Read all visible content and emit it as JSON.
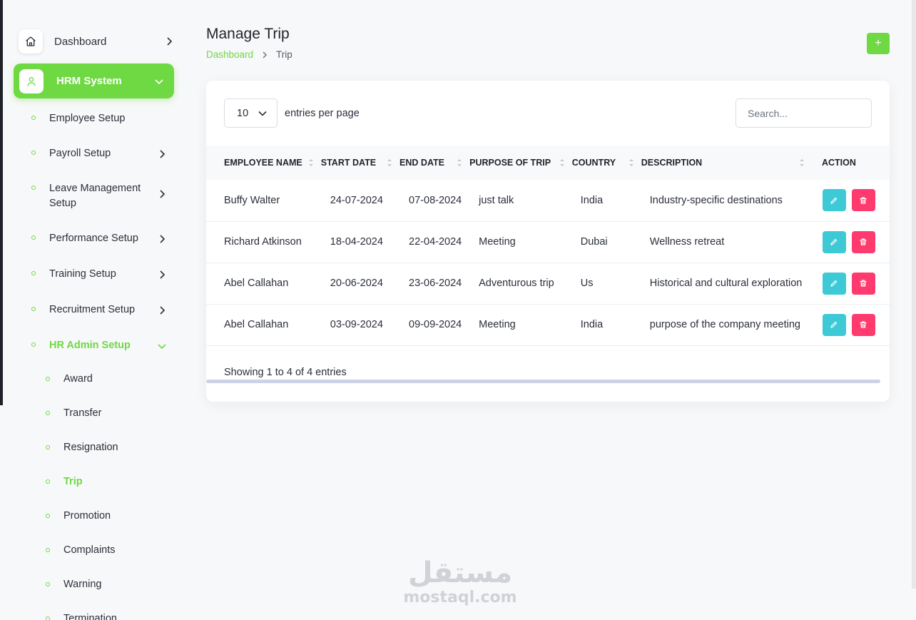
{
  "sidebar": {
    "dashboard": "Dashboard",
    "hrm": "HRM System",
    "items": [
      {
        "label": "Employee Setup"
      },
      {
        "label": "Payroll Setup"
      },
      {
        "label": "Leave Management Setup"
      },
      {
        "label": "Performance Setup"
      },
      {
        "label": "Training Setup"
      },
      {
        "label": "Recruitment Setup"
      },
      {
        "label": "HR Admin Setup"
      }
    ],
    "subitems": [
      {
        "label": "Award"
      },
      {
        "label": "Transfer"
      },
      {
        "label": "Resignation"
      },
      {
        "label": "Trip"
      },
      {
        "label": "Promotion"
      },
      {
        "label": "Complaints"
      },
      {
        "label": "Warning"
      },
      {
        "label": "Termination"
      }
    ]
  },
  "header": {
    "title": "Manage Trip",
    "breadcrumb_home": "Dashboard",
    "breadcrumb_current": "Trip",
    "add_label": "+"
  },
  "table": {
    "page_size": "10",
    "entries_label": "entries per page",
    "search_placeholder": "Search...",
    "columns": [
      "Employee Name",
      "Start Date",
      "End Date",
      "Purpose of Trip",
      "Country",
      "Description",
      "Action"
    ],
    "rows": [
      {
        "name": "Buffy Walter",
        "start": "24-07-2024",
        "end": "07-08-2024",
        "purpose": "just talk",
        "country": "India",
        "description": "Industry-specific destinations"
      },
      {
        "name": "Richard Atkinson",
        "start": "18-04-2024",
        "end": "22-04-2024",
        "purpose": "Meeting",
        "country": "Dubai",
        "description": "Wellness retreat"
      },
      {
        "name": "Abel Callahan",
        "start": "20-06-2024",
        "end": "23-06-2024",
        "purpose": "Adventurous trip",
        "country": "Us",
        "description": "Historical and cultural exploration"
      },
      {
        "name": "Abel Callahan",
        "start": "03-09-2024",
        "end": "09-09-2024",
        "purpose": "Meeting",
        "country": "India",
        "description": "purpose of the company meeting"
      }
    ],
    "info": "Showing 1 to 4 of 4 entries"
  },
  "watermark": {
    "arabic": "مستقل",
    "latin": "mostaql.com"
  },
  "colors": {
    "accent": "#6fd943",
    "edit": "#3ec9d6",
    "delete": "#ff3a6e"
  },
  "icons": {
    "dashboard": "home-icon",
    "hrm": "user-icon",
    "edit": "pencil-icon",
    "delete": "trash-icon"
  }
}
